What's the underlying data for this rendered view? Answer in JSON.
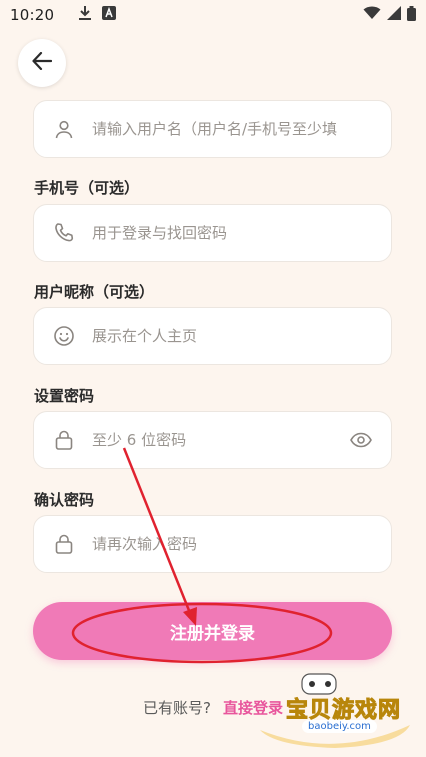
{
  "status_bar": {
    "time": "10:20",
    "icons": [
      "download-icon",
      "a-badge-icon",
      "wifi-icon",
      "signal-icon",
      "battery-icon"
    ]
  },
  "back": {
    "icon": "arrow-left-icon"
  },
  "fields": {
    "username": {
      "placeholder": "请输入用户名（用户名/手机号至少填",
      "icon": "user-icon"
    },
    "phone": {
      "label": "手机号（可选）",
      "placeholder": "用于登录与找回密码",
      "icon": "phone-icon"
    },
    "nickname": {
      "label": "用户昵称（可选）",
      "placeholder": "展示在个人主页",
      "icon": "smiley-icon"
    },
    "password": {
      "label": "设置密码",
      "placeholder": "至少 6 位密码",
      "icon": "lock-icon",
      "toggle_icon": "eye-icon"
    },
    "confirm": {
      "label": "确认密码",
      "placeholder": "请再次输入密码",
      "icon": "lock-icon"
    }
  },
  "submit": {
    "label": "注册并登录"
  },
  "login": {
    "prompt": "已有账号?",
    "link": "直接登录"
  },
  "watermark": {
    "text": "宝贝游戏网",
    "url": "baobeiy.com"
  },
  "colors": {
    "background": "#fdf5ee",
    "accent": "#f07ab7",
    "annotation": "#e0222f"
  }
}
